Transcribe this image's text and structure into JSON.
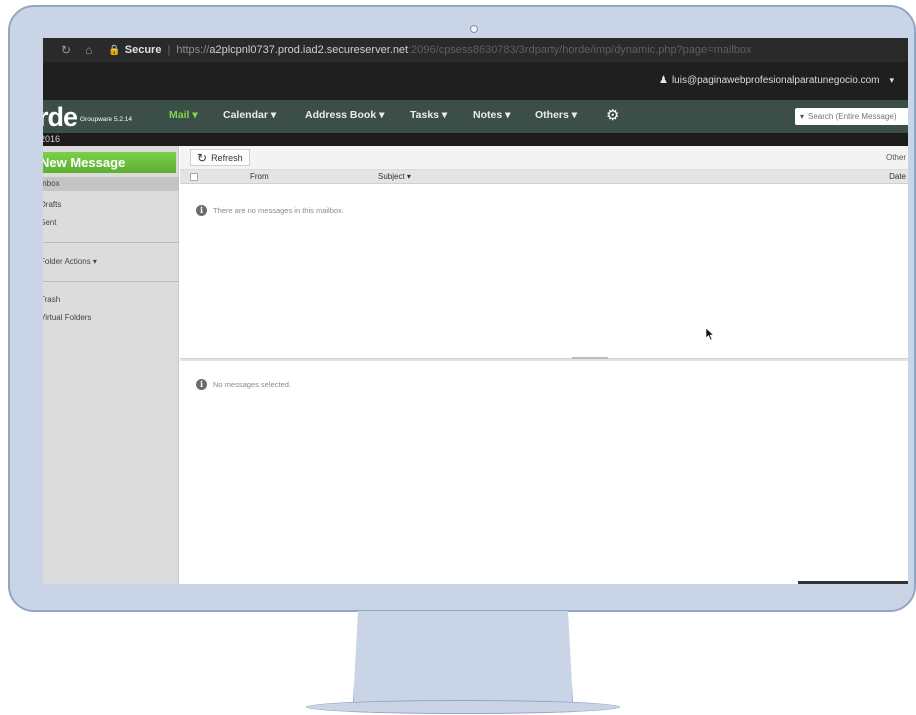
{
  "browser": {
    "back_icon": "reload-icon",
    "home_icon": "home-icon",
    "secure_label": "Secure",
    "url_scheme": "https://",
    "url_host": "a2plcpnl0737.prod.iad2.secureserver.net",
    "url_path": ":2096/cpsess8630783/3rdparty/horde/imp/dynamic.php?page=mailbox"
  },
  "user_bar": {
    "email": "luis@paginawebprofesionalparatunegocio.com"
  },
  "app": {
    "logo": "rde",
    "logo_sub": "Groupware 5.2.14",
    "year": "2016"
  },
  "nav": {
    "items": [
      "Mail",
      "Calendar",
      "Address Book",
      "Tasks",
      "Notes",
      "Others"
    ],
    "active": "Mail",
    "search_placeholder": "Search (Entire Message)"
  },
  "sidebar": {
    "new_message": "New Message",
    "folders": [
      "Inbox",
      "Drafts",
      "Sent"
    ],
    "folder_actions": "Folder Actions",
    "extra_folders": [
      "Trash",
      "Virtual Folders"
    ]
  },
  "toolbar": {
    "refresh_label": "Refresh",
    "other_label": "Other"
  },
  "columns": {
    "from": "From",
    "subject": "Subject",
    "date": "Date"
  },
  "messages": {
    "empty_text": "There are no messages in this mailbox.",
    "preview_text": "No messages selected."
  },
  "colors": {
    "nav_bg": "#3c4e48",
    "active_nav": "#7fd64b",
    "new_message_bg": "#6fc13f",
    "frame": "#c9d5e7"
  }
}
